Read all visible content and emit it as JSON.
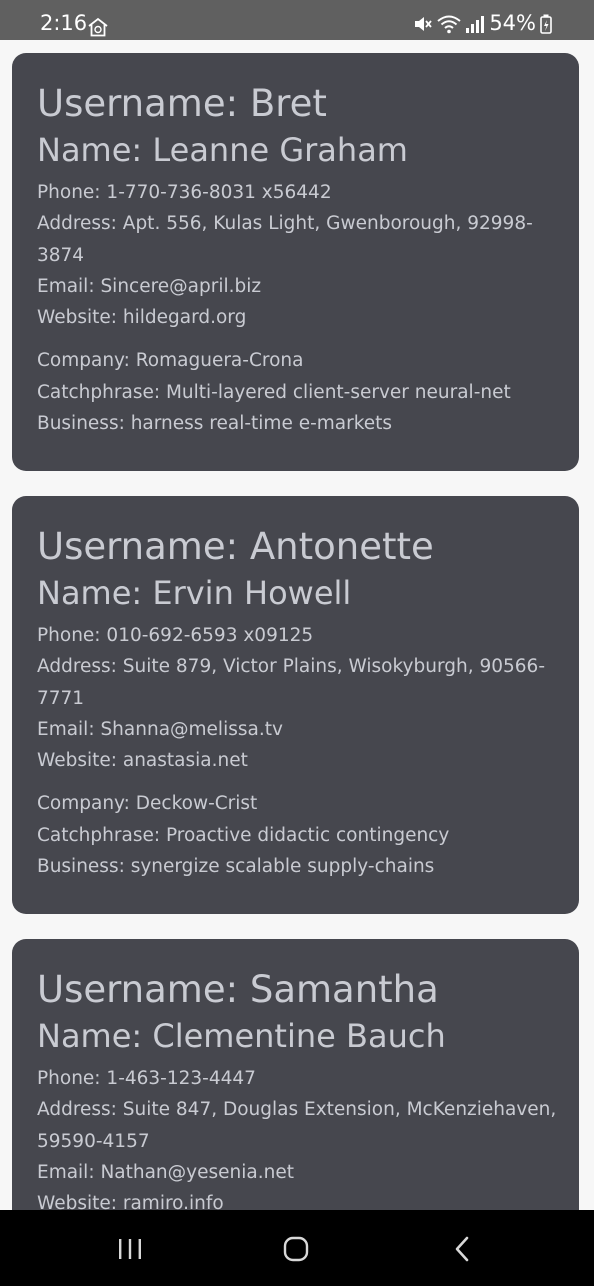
{
  "status_bar": {
    "time": "2:16",
    "battery": "54%"
  },
  "cards": [
    {
      "username": "Username: Bret",
      "name": "Name: Leanne Graham",
      "phone": "Phone: 1-770-736-8031 x56442",
      "address": "Address: Apt. 556, Kulas Light, Gwenborough, 92998-3874",
      "email": "Email: Sincere@april.biz",
      "website": "Website: hildegard.org",
      "company": "Company: Romaguera-Crona",
      "catchphrase": "Catchphrase: Multi-layered client-server neural-net",
      "business": "Business: harness real-time e-markets"
    },
    {
      "username": "Username: Antonette",
      "name": "Name: Ervin Howell",
      "phone": "Phone: 010-692-6593 x09125",
      "address": "Address: Suite 879, Victor Plains, Wisokyburgh, 90566-7771",
      "email": "Email: Shanna@melissa.tv",
      "website": "Website: anastasia.net",
      "company": "Company: Deckow-Crist",
      "catchphrase": "Catchphrase: Proactive didactic contingency",
      "business": "Business: synergize scalable supply-chains"
    },
    {
      "username": "Username: Samantha",
      "name": "Name: Clementine Bauch",
      "phone": "Phone: 1-463-123-4447",
      "address": "Address: Suite 847, Douglas Extension, McKenziehaven, 59590-4157",
      "email": "Email: Nathan@yesenia.net",
      "website": "Website: ramiro.info"
    }
  ],
  "nav_bar": {
    "recents_icon": "recent-apps-icon",
    "home_icon": "home-icon",
    "back_icon": "back-icon"
  }
}
